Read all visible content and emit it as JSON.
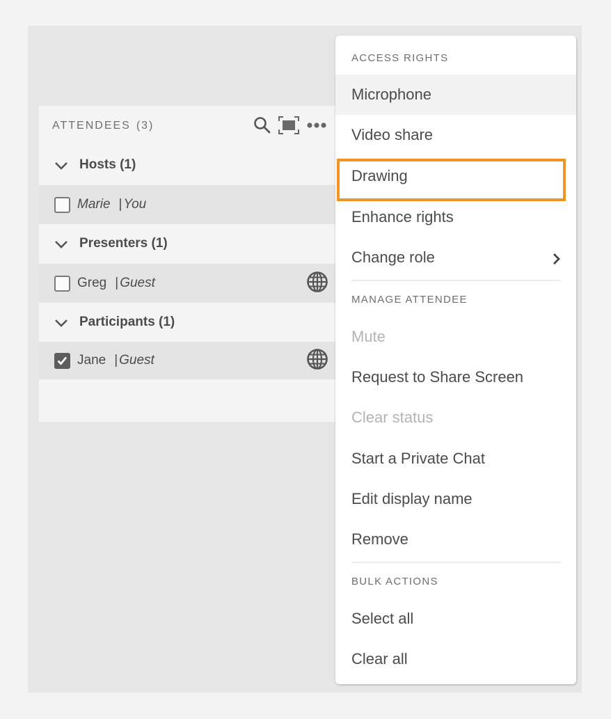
{
  "attendees_panel": {
    "title": "ATTENDEES",
    "count": "(3)",
    "header_icons": [
      "search-icon",
      "fullscreen-icon",
      "more-options-icon"
    ],
    "groups": [
      {
        "label": "Hosts (1)",
        "members": [
          {
            "name": "Marie",
            "separator": "|",
            "role": "You",
            "checked": false,
            "italic_name": true,
            "status_icon": null
          }
        ]
      },
      {
        "label": "Presenters (1)",
        "members": [
          {
            "name": "Greg",
            "separator": "|",
            "role": "Guest",
            "checked": false,
            "italic_name": false,
            "status_icon": "globe-icon"
          }
        ]
      },
      {
        "label": "Participants (1)",
        "members": [
          {
            "name": "Jane",
            "separator": "|",
            "role": "Guest",
            "checked": true,
            "italic_name": false,
            "status_icon": "globe-icon"
          }
        ]
      }
    ]
  },
  "context_menu": {
    "sections": [
      {
        "heading": "ACCESS RIGHTS",
        "items": [
          {
            "label": "Microphone",
            "state": "hovered"
          },
          {
            "label": "Video share",
            "state": "enabled"
          },
          {
            "label": "Drawing",
            "state": "highlighted"
          },
          {
            "label": "Enhance rights",
            "state": "enabled"
          },
          {
            "label": "Change role",
            "state": "enabled",
            "submenu": true
          }
        ]
      },
      {
        "heading": "MANAGE ATTENDEE",
        "items": [
          {
            "label": "Mute",
            "state": "disabled"
          },
          {
            "label": "Request to Share Screen",
            "state": "enabled"
          },
          {
            "label": "Clear status",
            "state": "disabled"
          },
          {
            "label": "Start a Private Chat",
            "state": "enabled"
          },
          {
            "label": "Edit display name",
            "state": "enabled"
          },
          {
            "label": "Remove",
            "state": "enabled"
          }
        ]
      },
      {
        "heading": "BULK ACTIONS",
        "items": [
          {
            "label": "Select all",
            "state": "enabled"
          },
          {
            "label": "Clear all",
            "state": "enabled"
          }
        ]
      }
    ]
  },
  "colors": {
    "highlight_border": "#f29423",
    "text": "#4b4b4b",
    "disabled_text": "#b3b3b3",
    "section_heading": "#6e6e6e"
  }
}
